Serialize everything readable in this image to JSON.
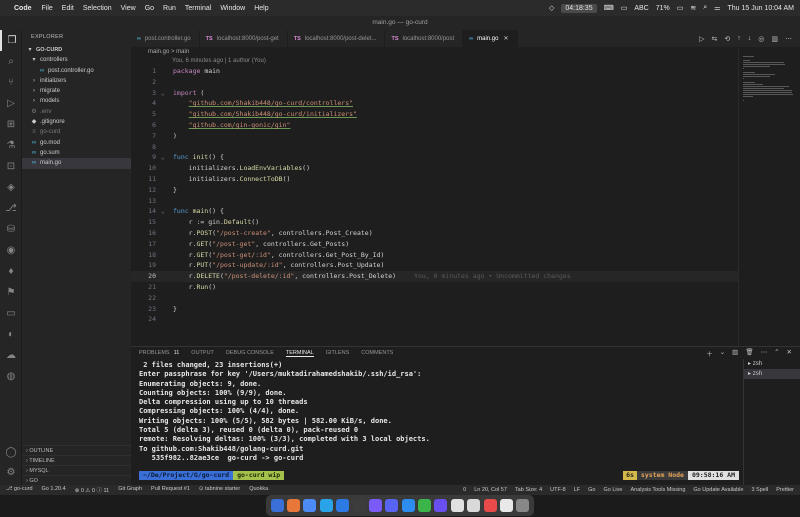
{
  "menubar": {
    "app": "Code",
    "items": [
      "File",
      "Edit",
      "Selection",
      "View",
      "Go",
      "Run",
      "Terminal",
      "Window",
      "Help"
    ],
    "recording_time": "04:18:35",
    "input_source": "ABC",
    "battery": "71%",
    "datetime": "Thu 15 Jun  10:04 AM"
  },
  "window": {
    "title": "main.go — go-curd"
  },
  "activity_icons": [
    "files-icon",
    "search-icon",
    "source-control-icon",
    "run-debug-icon",
    "extensions-icon",
    "testing-icon",
    "remote-explorer-icon",
    "docker-icon",
    "git-graph-icon",
    "database-icon",
    "github-icon",
    "mongodb-icon",
    "bookmark-icon",
    "terminal-icon",
    "tabnine-icon",
    "cloud-icon",
    "gitlens-icon"
  ],
  "sidebar": {
    "header": "EXPLORER",
    "project": "GO-CURD",
    "tree": [
      {
        "label": "controllers",
        "icon": "▾",
        "indent": 1,
        "type": "folder"
      },
      {
        "label": "post.controller.go",
        "icon": "∞",
        "indent": 2,
        "type": "go"
      },
      {
        "label": "initializers",
        "icon": "›",
        "indent": 1,
        "type": "folder"
      },
      {
        "label": "migrate",
        "icon": "›",
        "indent": 1,
        "type": "folder"
      },
      {
        "label": "models",
        "icon": "›",
        "indent": 1,
        "type": "folder"
      },
      {
        "label": ".env",
        "icon": "⚙",
        "indent": 1,
        "type": "dim"
      },
      {
        "label": ".gitignore",
        "icon": "◆",
        "indent": 1,
        "type": "file"
      },
      {
        "label": "go-curd",
        "icon": "≡",
        "indent": 1,
        "type": "dim"
      },
      {
        "label": "go.mod",
        "icon": "∞",
        "indent": 1,
        "type": "file"
      },
      {
        "label": "go.sum",
        "icon": "∞",
        "indent": 1,
        "type": "file"
      },
      {
        "label": "main.go",
        "icon": "∞",
        "indent": 1,
        "type": "selected"
      }
    ],
    "sections": [
      "OUTLINE",
      "TIMELINE",
      "MYSQL",
      "GO"
    ]
  },
  "tabs": [
    {
      "icon": "∞",
      "label": "post.controller.go",
      "active": false
    },
    {
      "icon": "TS",
      "label": "localhost:8000/post-get",
      "active": false
    },
    {
      "icon": "TS",
      "label": "localhost:8000/post-delet...",
      "active": false
    },
    {
      "icon": "TS",
      "label": "localhost:8000/post",
      "active": false
    },
    {
      "icon": "∞",
      "label": "main.go",
      "active": true
    }
  ],
  "breadcrumb": "main.go  >  main",
  "blame_header": "You, 6 minutes ago | 1 author (You)",
  "code": [
    [
      {
        "c": "kw",
        "t": "package"
      },
      {
        "c": "pk",
        "t": " main"
      }
    ],
    [],
    [
      {
        "c": "kw",
        "t": "import"
      },
      {
        "c": "pk",
        "t": " ("
      }
    ],
    [
      {
        "c": "pk",
        "t": "    "
      },
      {
        "c": "str-u",
        "t": "\"github.com/Shakib448/go-curd/controllers\""
      }
    ],
    [
      {
        "c": "pk",
        "t": "    "
      },
      {
        "c": "str-u",
        "t": "\"github.com/Shakib448/go-curd/initializers\""
      }
    ],
    [
      {
        "c": "pk",
        "t": "    "
      },
      {
        "c": "str-u",
        "t": "\"github.com/gin-gonic/gin\""
      }
    ],
    [
      {
        "c": "pk",
        "t": ")"
      }
    ],
    [],
    [
      {
        "c": "kw2",
        "t": "func"
      },
      {
        "c": "fn",
        "t": " init"
      },
      {
        "c": "pk",
        "t": "() {"
      }
    ],
    [
      {
        "c": "pk",
        "t": "    initializers."
      },
      {
        "c": "fn",
        "t": "LoadEnvVariables"
      },
      {
        "c": "pk",
        "t": "()"
      }
    ],
    [
      {
        "c": "pk",
        "t": "    initializers."
      },
      {
        "c": "fn",
        "t": "ConnectToDB"
      },
      {
        "c": "pk",
        "t": "()"
      }
    ],
    [
      {
        "c": "pk",
        "t": "}"
      }
    ],
    [],
    [
      {
        "c": "kw2",
        "t": "func"
      },
      {
        "c": "fn",
        "t": " main"
      },
      {
        "c": "pk",
        "t": "() {"
      }
    ],
    [
      {
        "c": "pk",
        "t": "    r := gin."
      },
      {
        "c": "fn",
        "t": "Default"
      },
      {
        "c": "pk",
        "t": "()"
      }
    ],
    [
      {
        "c": "pk",
        "t": "    r."
      },
      {
        "c": "fn",
        "t": "POST"
      },
      {
        "c": "pk",
        "t": "("
      },
      {
        "c": "str",
        "t": "\"/post-create\""
      },
      {
        "c": "pk",
        "t": ", controllers.Post_Create)"
      }
    ],
    [
      {
        "c": "pk",
        "t": "    r."
      },
      {
        "c": "fn",
        "t": "GET"
      },
      {
        "c": "pk",
        "t": "("
      },
      {
        "c": "str",
        "t": "\"/post-get\""
      },
      {
        "c": "pk",
        "t": ", controllers.Get_Posts)"
      }
    ],
    [
      {
        "c": "pk",
        "t": "    r."
      },
      {
        "c": "fn",
        "t": "GET"
      },
      {
        "c": "pk",
        "t": "("
      },
      {
        "c": "str",
        "t": "\"/post-get/:id\""
      },
      {
        "c": "pk",
        "t": ", controllers.Get_Post_By_Id)"
      }
    ],
    [
      {
        "c": "pk",
        "t": "    r."
      },
      {
        "c": "fn",
        "t": "PUT"
      },
      {
        "c": "pk",
        "t": "("
      },
      {
        "c": "str",
        "t": "\"/post-update/:id\""
      },
      {
        "c": "pk",
        "t": ", controllers.Post_Update)"
      }
    ],
    [
      {
        "c": "pk",
        "t": "    r."
      },
      {
        "c": "fn",
        "t": "DELETE"
      },
      {
        "c": "pk",
        "t": "("
      },
      {
        "c": "str",
        "t": "\"/post-delete/:id\""
      },
      {
        "c": "pk",
        "t": ", controllers.Post_Delete)"
      },
      {
        "c": "ghost",
        "t": "You, 6 minutes ago • Uncommitted changes"
      }
    ],
    [
      {
        "c": "pk",
        "t": "    r."
      },
      {
        "c": "fn",
        "t": "Run"
      },
      {
        "c": "pk",
        "t": "()"
      }
    ],
    [],
    [
      {
        "c": "pk",
        "t": "}"
      }
    ],
    []
  ],
  "current_line": 20,
  "fold_lines": [
    3,
    9,
    14
  ],
  "panel": {
    "tabs": [
      "PROBLEMS",
      "OUTPUT",
      "DEBUG CONSOLE",
      "TERMINAL",
      "GITLENS",
      "COMMENTS"
    ],
    "problems_count": "11",
    "active_tab": "TERMINAL",
    "terminal_lines": [
      " 2 files changed, 23 insertions(+)",
      "Enter passphrase for key '/Users/muktadirahamedshakib/.ssh/id_rsa':",
      "Enumerating objects: 9, done.",
      "Counting objects: 100% (9/9), done.",
      "Delta compression using up to 10 threads",
      "Compressing objects: 100% (4/4), done.",
      "Writing objects: 100% (5/5), 582 bytes | 582.00 KiB/s, done.",
      "Total 5 (delta 3), reused 0 (delta 0), pack-reused 0",
      "remote: Resolving deltas: 100% (3/3), completed with 3 local objects.",
      "To github.com:Shakib448/golang-curd.git",
      "   535f982..82ae3ce  go-curd -> go-curd"
    ],
    "prompt_dir": " ~/De/Project/G/go-curd ",
    "prompt_git": " go-curd wip ",
    "prompt_time": "6s",
    "prompt_env": "system Node",
    "prompt_clock": "09:58:16 AM",
    "terminals": [
      "zsh",
      "zsh"
    ]
  },
  "statusbar": {
    "left": [
      "⎇ go-curd",
      "Go 1.20.4",
      "⊗ 0 ⚠ 0 ⓘ 11",
      "Git Graph",
      "Pull Request #1",
      "⊙ tabnine starter",
      "Quokka"
    ],
    "right": [
      "0",
      "Ln 20, Col 57",
      "Tab Size: 4",
      "UTF-8",
      "LF",
      "Go",
      "Go Live",
      "Analysis Tools Missing",
      "Go Update Available",
      "3 Spell",
      "Prettier"
    ]
  },
  "dock_colors": [
    "#3b6fd8",
    "#e8773a",
    "#4c8bf5",
    "#2aa3e8",
    "#2c7be5",
    "#3c3c3c",
    "#7a5af8",
    "#5865f2",
    "#2d8cf0",
    "#3bb54a",
    "#6a4ff0",
    "#e0e0e0",
    "#d9d9d9",
    "#e94b4b",
    "#e8e8e8",
    "#888888"
  ]
}
